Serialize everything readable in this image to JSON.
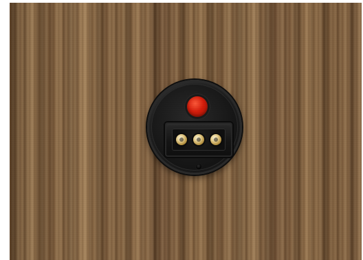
{
  "scene": {
    "colors": {
      "page_background": "#ffffff",
      "wood_base": "#7a5a3a",
      "socket_body": "#1f1f1f",
      "indicator_red": "#d81d0b",
      "pin_metal": "#e9d18f"
    },
    "icons": {
      "indicator": "red-indicator-light",
      "pins": [
        "contact-pin",
        "contact-pin",
        "contact-pin"
      ],
      "screw_hole": "screw-hole"
    }
  }
}
